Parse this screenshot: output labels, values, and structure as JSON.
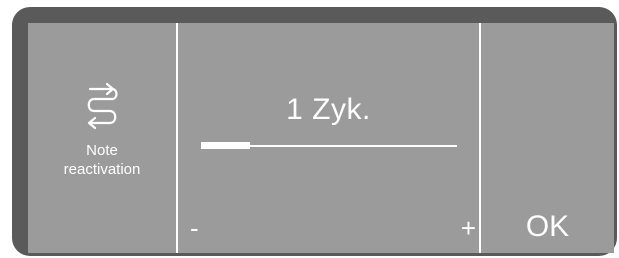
{
  "left_panel": {
    "icon": "reactivation-loop-icon",
    "label_line1": "Note",
    "label_line2": "reactivation"
  },
  "main": {
    "value_text": "1 Zyk.",
    "slider_level": 0.19,
    "minus_label": "-",
    "plus_label": "+"
  },
  "right_panel": {
    "ok_label": "OK"
  },
  "colors": {
    "screen_bg": "#9b9b9b",
    "bezel": "#5a5a5a",
    "foreground": "#ffffff"
  }
}
